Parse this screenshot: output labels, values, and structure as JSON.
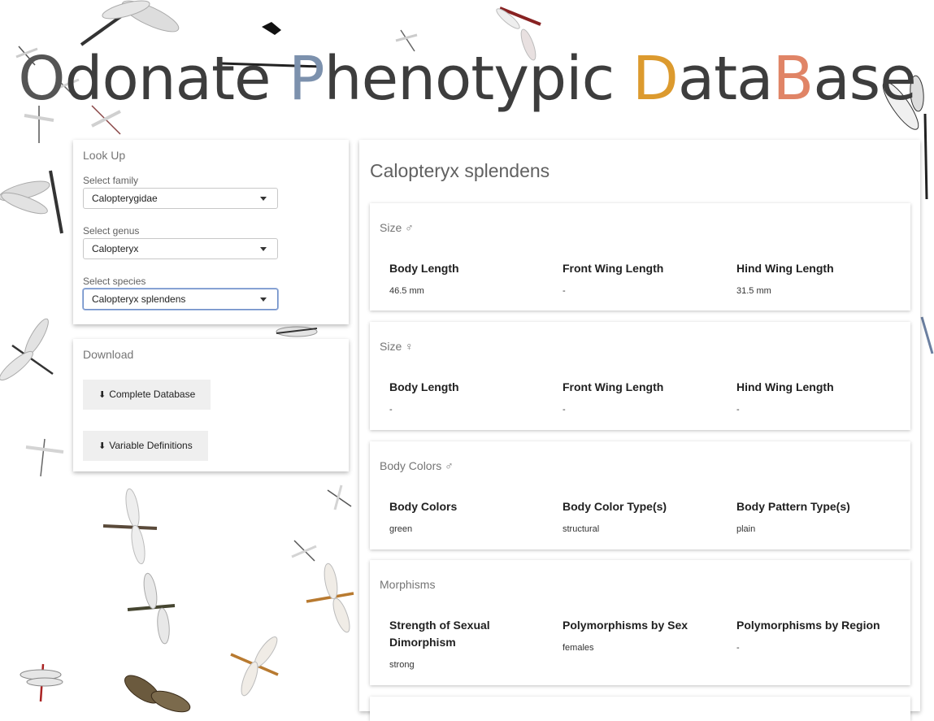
{
  "site": {
    "title_parts": [
      "O",
      "donate ",
      "P",
      "henotypic ",
      "D",
      "ata",
      "B",
      "ase"
    ]
  },
  "lookup": {
    "title": "Look Up",
    "family_label": "Select family",
    "family_value": "Calopterygidae",
    "genus_label": "Select genus",
    "genus_value": "Calopteryx",
    "species_label": "Select species",
    "species_value": "Calopteryx splendens"
  },
  "download": {
    "title": "Download",
    "complete_label": "Complete Database",
    "definitions_label": "Variable Definitions"
  },
  "species": {
    "name": "Calopteryx splendens",
    "sections": [
      {
        "title": "Size ♂",
        "cols": [
          {
            "header": "Body Length",
            "value": "46.5 mm"
          },
          {
            "header": "Front Wing Length",
            "value": "-"
          },
          {
            "header": "Hind Wing Length",
            "value": "31.5 mm"
          }
        ]
      },
      {
        "title": "Size ♀",
        "cols": [
          {
            "header": "Body Length",
            "value": "-"
          },
          {
            "header": "Front Wing Length",
            "value": "-"
          },
          {
            "header": "Hind Wing Length",
            "value": "-"
          }
        ]
      },
      {
        "title": "Body Colors ♂",
        "cols": [
          {
            "header": "Body Colors",
            "value": "green"
          },
          {
            "header": "Body Color Type(s)",
            "value": "structural"
          },
          {
            "header": "Body Pattern Type(s)",
            "value": "plain"
          }
        ]
      },
      {
        "title": "Morphisms",
        "cols": [
          {
            "header": "Strength of Sexual Dimorphism",
            "value": "strong"
          },
          {
            "header": "Polymorphisms by Sex",
            "value": "females"
          },
          {
            "header": "Polymorphisms by Region",
            "value": "-"
          }
        ]
      }
    ]
  },
  "colors": {
    "title_o": "#555555",
    "title_p": "#7c91ad",
    "title_d": "#dc9a2e",
    "title_b": "#e08466"
  }
}
